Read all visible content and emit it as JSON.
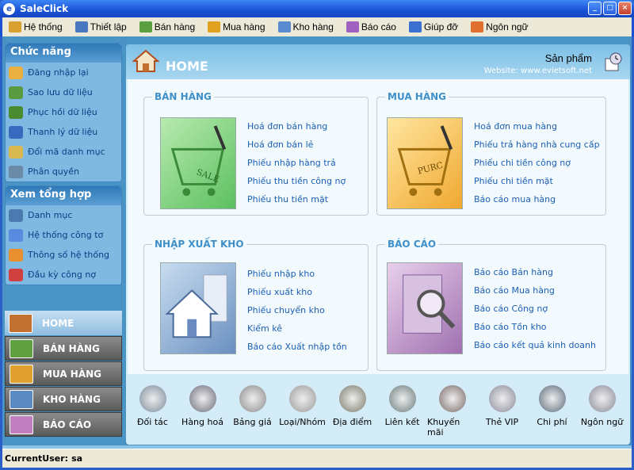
{
  "window": {
    "title": "SaleClick",
    "min": "_",
    "max": "□",
    "close": "×"
  },
  "menu": [
    {
      "label": "Hệ thống",
      "color": "#d9a030"
    },
    {
      "label": "Thiết lập",
      "color": "#4a78c0"
    },
    {
      "label": "Bán hàng",
      "color": "#5aa040"
    },
    {
      "label": "Mua hàng",
      "color": "#e0a020"
    },
    {
      "label": "Kho hàng",
      "color": "#5a8ad0"
    },
    {
      "label": "Báo cáo",
      "color": "#a060c0"
    },
    {
      "label": "Giúp đỡ",
      "color": "#3a70d0"
    },
    {
      "label": "Ngôn ngữ",
      "color": "#e07030"
    }
  ],
  "sidebar": {
    "chuc_nang": {
      "title": "Chức năng",
      "items": [
        {
          "label": "Đăng nhập lại",
          "color": "#e8b040"
        },
        {
          "label": "Sao lưu dữ liệu",
          "color": "#5a9a40"
        },
        {
          "label": "Phục hồi dữ liệu",
          "color": "#4a8a30"
        },
        {
          "label": "Thanh lý dữ liệu",
          "color": "#3a6ac0"
        },
        {
          "label": "Đổi mã danh mục",
          "color": "#d8b850"
        },
        {
          "label": "Phân quyền",
          "color": "#6a8aa8"
        }
      ]
    },
    "xem_tong_hop": {
      "title": "Xem tổng hợp",
      "items": [
        {
          "label": "Danh mục",
          "color": "#4a7ab0"
        },
        {
          "label": "Hệ thống công tơ",
          "color": "#5a8ae0"
        },
        {
          "label": "Thông số hệ thống",
          "color": "#e89030"
        },
        {
          "label": "Đầu kỳ công nợ",
          "color": "#d04040"
        }
      ]
    }
  },
  "nav": [
    {
      "label": "HOME",
      "color": "#c07030"
    },
    {
      "label": "BÁN HÀNG",
      "color": "#60a040"
    },
    {
      "label": "MUA HÀNG",
      "color": "#e0a030"
    },
    {
      "label": "KHO HÀNG",
      "color": "#5a8ac0"
    },
    {
      "label": "BÁO CÁO",
      "color": "#c080c0"
    }
  ],
  "header": {
    "title": "HOME",
    "product": "Sản phẩm",
    "website": "Website: www.evietsoft.net"
  },
  "panels": {
    "ban_hang": {
      "title": "BÁN HÀNG",
      "img_text": "SALE",
      "links": [
        "Hoá đơn bán hàng",
        "Hoá đơn bán lẻ",
        "Phiếu nhập hàng trả",
        "Phiếu thu tiền công nợ",
        "Phiếu thu tiền mặt"
      ]
    },
    "mua_hang": {
      "title": "MUA HÀNG",
      "img_text": "PURC",
      "links": [
        "Hoá đơn mua hàng",
        "Phiếu trả hàng nhà cung cấp",
        "Phiếu chi tiền công nợ",
        "Phiếu chi tiền mặt",
        "Báo cáo mua hàng"
      ]
    },
    "kho": {
      "title": "NHẬP XUẤT KHO",
      "links": [
        "Phiếu nhập kho",
        "Phiếu xuất kho",
        "Phiếu chuyển kho",
        "Kiểm kê",
        "Báo cáo Xuất nhập tồn"
      ]
    },
    "bao_cao": {
      "title": "BÁO CÁO",
      "links": [
        "Báo cáo Bán hàng",
        "Báo cáo Mua hàng",
        "Báo cáo Công nợ",
        "Báo cáo Tồn kho",
        "Báo cáo kết quả kinh doanh"
      ]
    }
  },
  "tools": [
    {
      "label": "Đối tác",
      "name": "partners-icon",
      "color": "#7a8a9a"
    },
    {
      "label": "Hàng hoá",
      "name": "goods-icon",
      "color": "#6a6a7a"
    },
    {
      "label": "Bảng giá",
      "name": "dollar-icon",
      "color": "#8a8a8a"
    },
    {
      "label": "Loại/Nhóm",
      "name": "cubes-icon",
      "color": "#9a9a9a"
    },
    {
      "label": "Địa điểm",
      "name": "location-icon",
      "color": "#7a7a6a"
    },
    {
      "label": "Liên kết",
      "name": "recycle-icon",
      "color": "#6a7a7a"
    },
    {
      "label": "Khuyến mãi",
      "name": "gift-icon",
      "color": "#7a6a6a"
    },
    {
      "label": "Thẻ VIP",
      "name": "vip-card-icon",
      "color": "#8a8a9a"
    },
    {
      "label": "Chi phí",
      "name": "cost-icon",
      "color": "#5a6a7a"
    },
    {
      "label": "Ngôn ngữ",
      "name": "globe-icon",
      "color": "#8a8a9a"
    }
  ],
  "status": {
    "label": "CurrentUser:",
    "user": "sa"
  }
}
